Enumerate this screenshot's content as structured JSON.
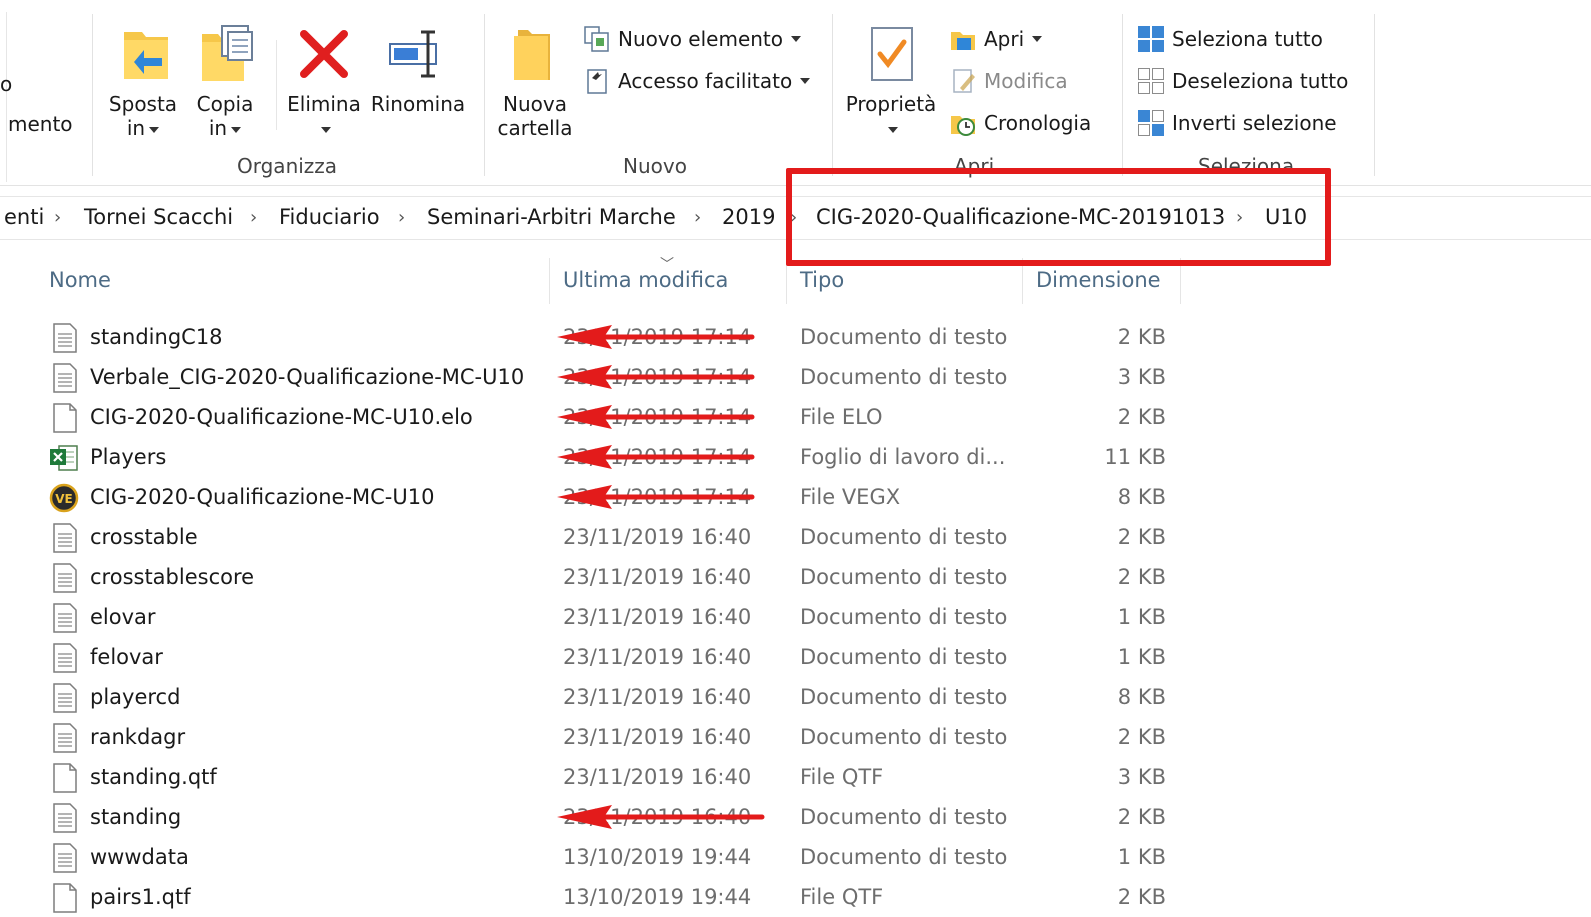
{
  "ribbon": {
    "left_cut_top": "o",
    "left_cut_label": "mento",
    "organizza": {
      "label": "Organizza",
      "sposta": {
        "line1": "Sposta",
        "line2": "in"
      },
      "copia": {
        "line1": "Copia",
        "line2": "in"
      },
      "elimina": {
        "line1": "Elimina"
      },
      "rinomina": {
        "line1": "Rinomina"
      }
    },
    "nuovo": {
      "label": "Nuovo",
      "nuova_cartella": {
        "line1": "Nuova",
        "line2": "cartella"
      },
      "nuovo_elemento": "Nuovo elemento",
      "accesso_facilitato": "Accesso facilitato"
    },
    "apri": {
      "label": "Apri",
      "proprieta": "Proprietà",
      "apri": "Apri",
      "modifica": "Modifica",
      "cronologia": "Cronologia"
    },
    "seleziona": {
      "label": "Seleziona",
      "seleziona_tutto": "Seleziona tutto",
      "deseleziona_tutto": "Deseleziona tutto",
      "inverti_selezione": "Inverti selezione"
    }
  },
  "breadcrumb": [
    "enti",
    "Tornei Scacchi",
    "Fiduciario",
    "Seminari-Arbitri Marche",
    "2019",
    "CIG-2020-Qualificazione-MC-20191013",
    "U10"
  ],
  "columns": {
    "name": "Nome",
    "modified": "Ultima modifica",
    "type": "Tipo",
    "size": "Dimensione"
  },
  "files": [
    {
      "name": "standingC18",
      "date": "23/11/2019 17:14",
      "type": "Documento di testo",
      "size": "2 KB",
      "icon": "text-document-icon"
    },
    {
      "name": "Verbale_CIG-2020-Qualificazione-MC-U10",
      "date": "23/11/2019 17:14",
      "type": "Documento di testo",
      "size": "3 KB",
      "icon": "text-document-icon"
    },
    {
      "name": "CIG-2020-Qualificazione-MC-U10.elo",
      "date": "23/11/2019 17:14",
      "type": "File ELO",
      "size": "2 KB",
      "icon": "blank-file-icon"
    },
    {
      "name": "Players",
      "date": "23/11/2019 17:14",
      "type": "Foglio di lavoro di...",
      "size": "11 KB",
      "icon": "excel-file-icon"
    },
    {
      "name": "CIG-2020-Qualificazione-MC-U10",
      "date": "23/11/2019 17:14",
      "type": "File VEGX",
      "size": "8 KB",
      "icon": "vega-file-icon"
    },
    {
      "name": "crosstable",
      "date": "23/11/2019 16:40",
      "type": "Documento di testo",
      "size": "2 KB",
      "icon": "text-document-icon"
    },
    {
      "name": "crosstablescore",
      "date": "23/11/2019 16:40",
      "type": "Documento di testo",
      "size": "2 KB",
      "icon": "text-document-icon"
    },
    {
      "name": "elovar",
      "date": "23/11/2019 16:40",
      "type": "Documento di testo",
      "size": "1 KB",
      "icon": "text-document-icon"
    },
    {
      "name": "felovar",
      "date": "23/11/2019 16:40",
      "type": "Documento di testo",
      "size": "1 KB",
      "icon": "text-document-icon"
    },
    {
      "name": "playercd",
      "date": "23/11/2019 16:40",
      "type": "Documento di testo",
      "size": "8 KB",
      "icon": "text-document-icon"
    },
    {
      "name": "rankdagr",
      "date": "23/11/2019 16:40",
      "type": "Documento di testo",
      "size": "2 KB",
      "icon": "text-document-icon"
    },
    {
      "name": "standing.qtf",
      "date": "23/11/2019 16:40",
      "type": "File QTF",
      "size": "3 KB",
      "icon": "blank-file-icon"
    },
    {
      "name": "standing",
      "date": "23/11/2019 16:40",
      "type": "Documento di testo",
      "size": "2 KB",
      "icon": "text-document-icon"
    },
    {
      "name": "wwwdata",
      "date": "13/10/2019 19:44",
      "type": "Documento di testo",
      "size": "1 KB",
      "icon": "text-document-icon"
    },
    {
      "name": "pairs1.qtf",
      "date": "13/10/2019 19:44",
      "type": "File QTF",
      "size": "2 KB",
      "icon": "blank-file-icon"
    }
  ],
  "annotations": {
    "highlight_color": "#e31b1b",
    "arrow_rows": [
      0,
      1,
      2,
      3,
      4,
      12
    ]
  }
}
